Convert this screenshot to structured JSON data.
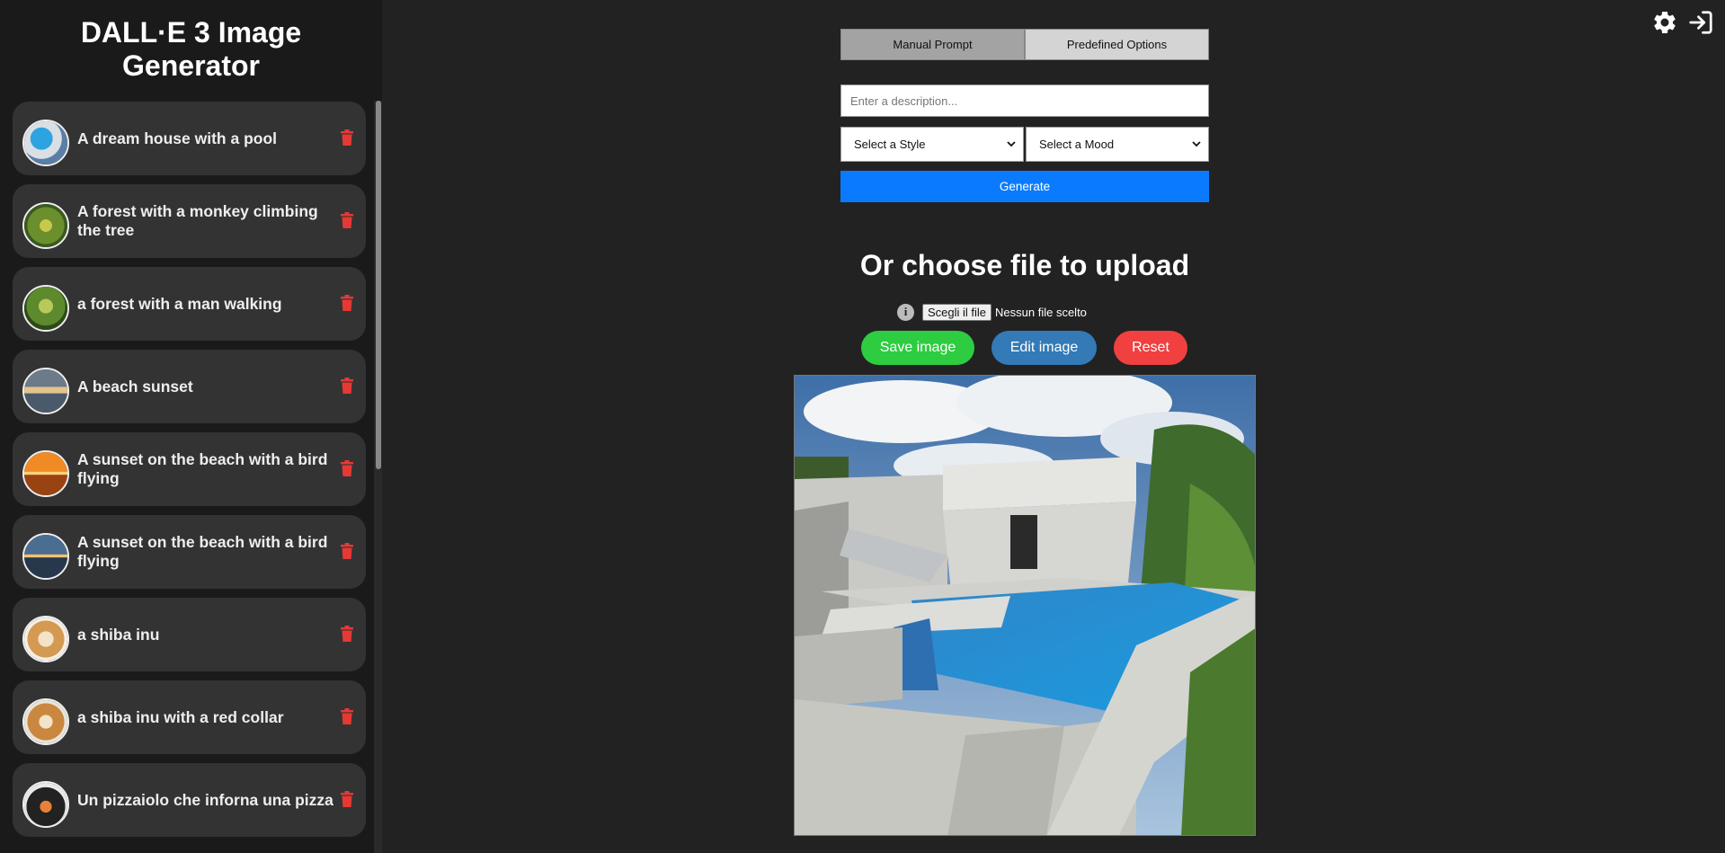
{
  "sidebar": {
    "title": "DALL·E 3 Image Generator",
    "items": [
      {
        "label": "A dream house with a pool",
        "thumb": "pool"
      },
      {
        "label": "A forest with a monkey climbing the tree",
        "thumb": "forest"
      },
      {
        "label": "a forest with a man walking",
        "thumb": "forest2"
      },
      {
        "label": "A beach sunset",
        "thumb": "beach"
      },
      {
        "label": "A sunset on the beach with a bird flying",
        "thumb": "sunset-orange"
      },
      {
        "label": "A sunset on the beach with a bird flying",
        "thumb": "sunset-blue"
      },
      {
        "label": "a shiba inu",
        "thumb": "shiba"
      },
      {
        "label": "a shiba inu with a red collar",
        "thumb": "shiba2"
      },
      {
        "label": "Un pizzaiolo che inforna una pizza",
        "thumb": "pizza"
      }
    ]
  },
  "header": {
    "icons": [
      "gear-icon",
      "sign-in-icon"
    ]
  },
  "form": {
    "tabs": [
      {
        "label": "Manual Prompt",
        "active": true
      },
      {
        "label": "Predefined Options",
        "active": false
      }
    ],
    "description_placeholder": "Enter a description...",
    "style_select": "Select a Style",
    "mood_select": "Select a Mood",
    "generate_label": "Generate"
  },
  "upload": {
    "heading": "Or choose file to upload",
    "file_button": "Scegli il file",
    "file_status": "Nessun file scelto"
  },
  "actions": {
    "save_label": "Save image",
    "edit_label": "Edit image",
    "reset_label": "Reset"
  },
  "colors": {
    "accent_blue": "#0a7bff",
    "save_green": "#2ecc40",
    "edit_blue": "#337ab7",
    "reset_red": "#f04040",
    "trash_red": "#e53935"
  }
}
